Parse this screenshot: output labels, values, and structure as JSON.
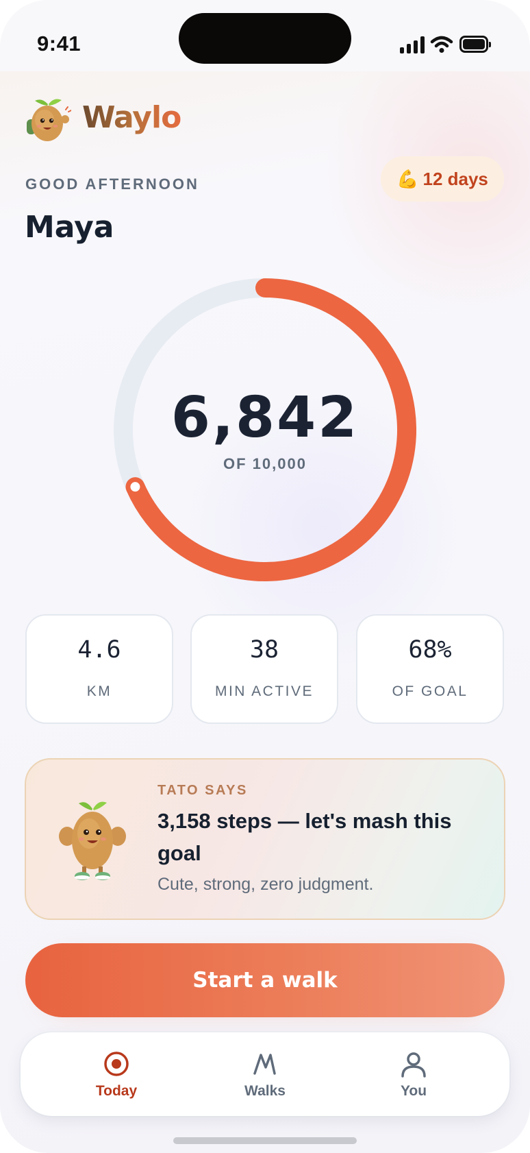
{
  "status_bar": {
    "time": "9:41"
  },
  "brand": {
    "name": "Waylo"
  },
  "greeting": {
    "kicker": "GOOD AFTERNOON",
    "name": "Maya"
  },
  "streak": {
    "icon": "💪",
    "label": "12 days"
  },
  "steps": {
    "value": "6,842",
    "goal_label": "OF 10,000",
    "progress": 0.6842
  },
  "stats": [
    {
      "value": "4.6",
      "label": "KM"
    },
    {
      "value": "38",
      "label": "MIN ACTIVE"
    },
    {
      "value": "68%",
      "label": "OF GOAL"
    }
  ],
  "tato": {
    "kicker": "TATO SAYS",
    "title": "3,158 steps — let's mash this goal",
    "subtitle": "Cute, strong, zero judgment."
  },
  "cta": {
    "label": "Start a walk"
  },
  "tabs": [
    {
      "label": "Today",
      "icon": "target-icon",
      "active": true
    },
    {
      "label": "Walks",
      "icon": "walk-path-icon",
      "active": false
    },
    {
      "label": "You",
      "icon": "person-icon",
      "active": false
    }
  ],
  "colors": {
    "accent": "#EC6641",
    "ring_track": "#E7ECF3",
    "text_dark": "#1B2333",
    "text_muted": "#5F6B7A",
    "active_tab": "#B8391C"
  }
}
